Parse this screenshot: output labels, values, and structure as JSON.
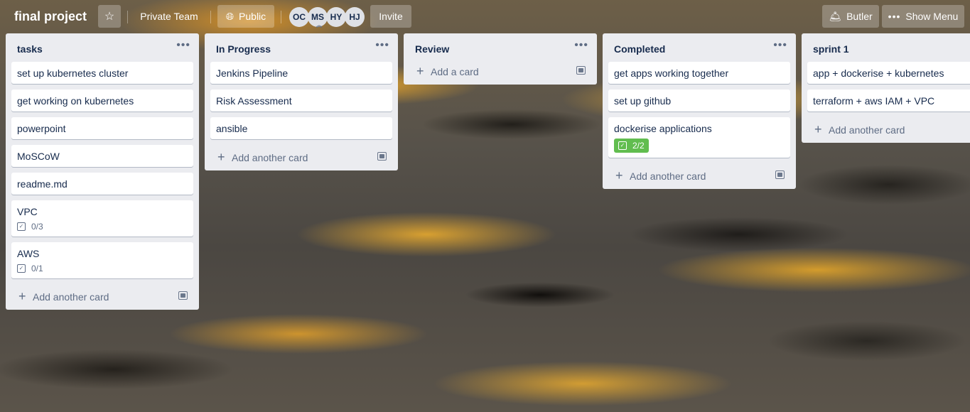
{
  "header": {
    "board_title": "final project",
    "star_icon": "star-icon",
    "team_label": "Private Team",
    "visibility_label": "Public",
    "members": [
      {
        "initials": "OC"
      },
      {
        "initials": "MS"
      },
      {
        "initials": "HY"
      },
      {
        "initials": "HJ"
      }
    ],
    "invite_label": "Invite",
    "butler_label": "Butler",
    "show_menu_label": "Show Menu"
  },
  "lists": [
    {
      "title": "tasks",
      "cards": [
        {
          "title": "set up kubernetes cluster"
        },
        {
          "title": "get working on kubernetes"
        },
        {
          "title": "powerpoint"
        },
        {
          "title": "MoSCoW"
        },
        {
          "title": "readme.md"
        },
        {
          "title": "VPC",
          "checklist": "0/3"
        },
        {
          "title": "AWS",
          "checklist": "0/1"
        }
      ],
      "add_label": "Add another card"
    },
    {
      "title": "In Progress",
      "cards": [
        {
          "title": "Jenkins Pipeline"
        },
        {
          "title": "Risk Assessment"
        },
        {
          "title": "ansible"
        }
      ],
      "add_label": "Add another card"
    },
    {
      "title": "Review",
      "cards": [],
      "add_label": "Add a card"
    },
    {
      "title": "Completed",
      "cards": [
        {
          "title": "get apps working together"
        },
        {
          "title": "set up github"
        },
        {
          "title": "dockerise applications",
          "checklist": "2/2",
          "checklist_complete": true
        }
      ],
      "add_label": "Add another card"
    },
    {
      "title": "sprint 1",
      "cards": [
        {
          "title": "app + dockerise + kubernetes"
        },
        {
          "title": "terraform + aws IAM + VPC"
        }
      ],
      "add_label": "Add another card"
    }
  ],
  "colors": {
    "list_bg": "#ebecf0",
    "card_bg": "#ffffff",
    "checklist_done": "#61bd4f",
    "text": "#172b4d"
  }
}
